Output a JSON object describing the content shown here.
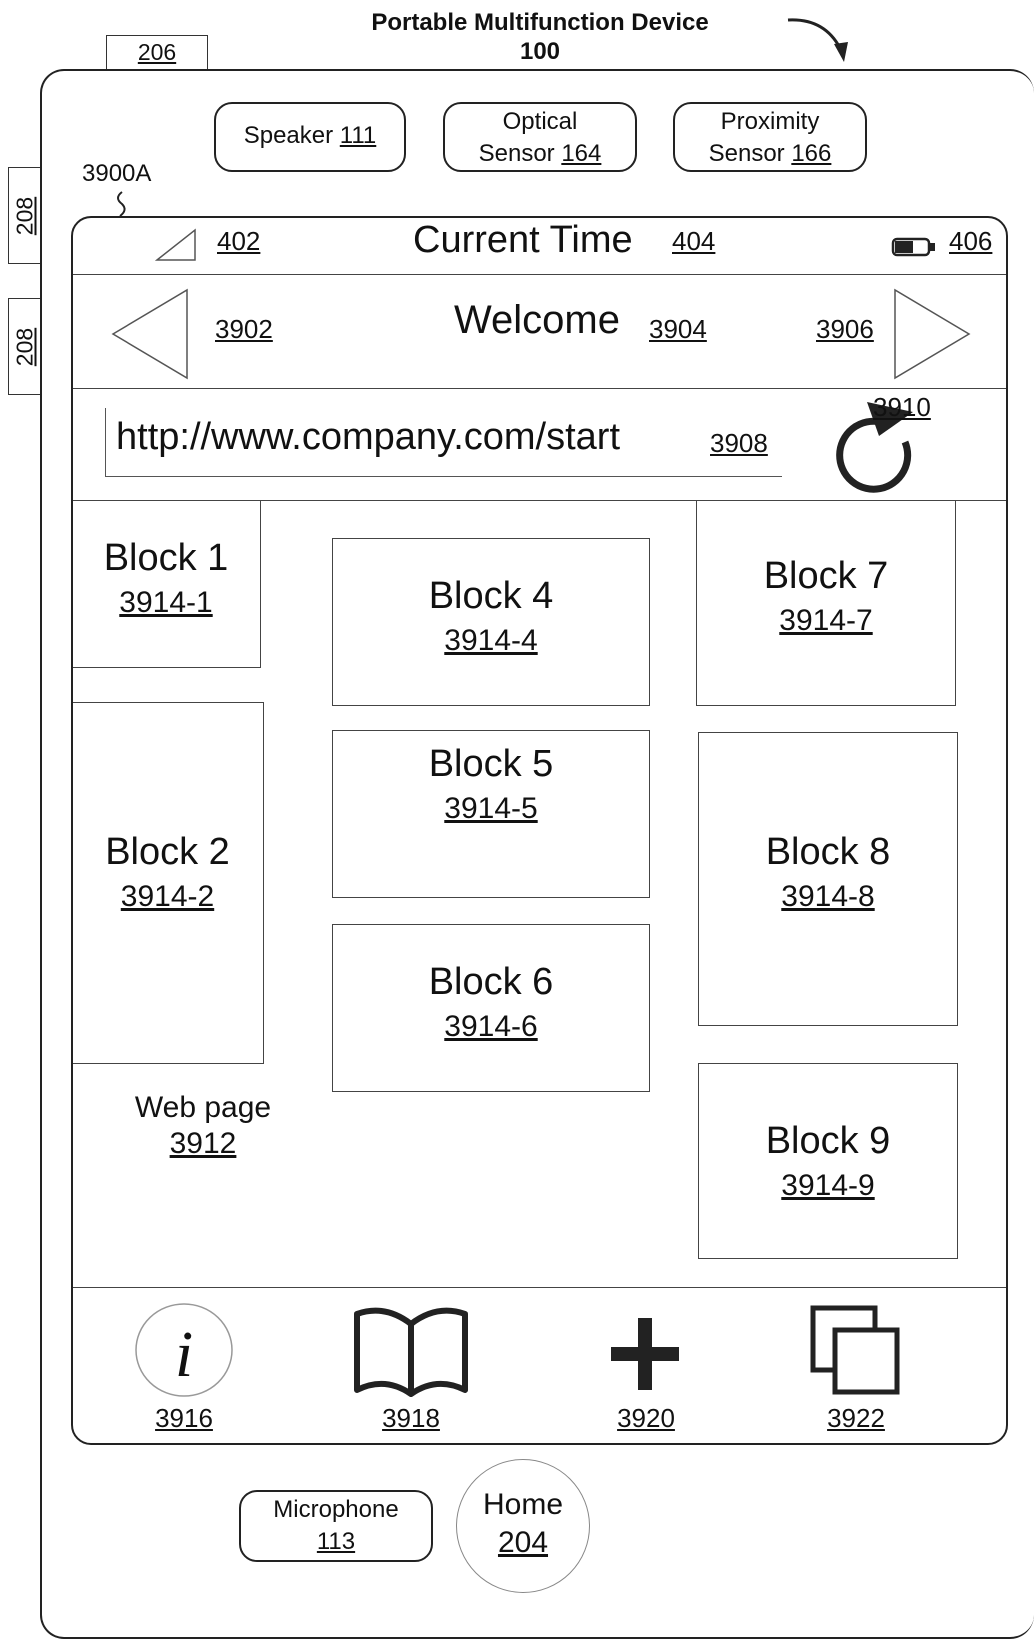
{
  "header": {
    "title": "Portable Multifunction Device",
    "number": "100",
    "tab_top": "206",
    "side_tabs": [
      "208",
      "208"
    ],
    "screen_label": "3900A"
  },
  "sensors": [
    {
      "name": "Speaker",
      "ref": "111"
    },
    {
      "name": "Optical",
      "name2": "Sensor",
      "ref": "164"
    },
    {
      "name": "Proximity",
      "name2": "Sensor",
      "ref": "166"
    }
  ],
  "status_bar": {
    "signal_ref": "402",
    "time_label": "Current Time",
    "time_ref": "404",
    "battery_ref": "406"
  },
  "nav_bar": {
    "back_ref": "3902",
    "title": "Welcome",
    "title_ref": "3904",
    "forward_ref": "3906"
  },
  "url_bar": {
    "url": "http://www.company.com/start",
    "url_ref": "3908",
    "refresh_ref": "3910"
  },
  "web_page": {
    "label": "Web page",
    "ref": "3912",
    "blocks": [
      {
        "title": "Block 1",
        "ref": "3914-1"
      },
      {
        "title": "Block 2",
        "ref": "3914-2"
      },
      {
        "title": "Block 4",
        "ref": "3914-4"
      },
      {
        "title": "Block 5",
        "ref": "3914-5"
      },
      {
        "title": "Block 6",
        "ref": "3914-6"
      },
      {
        "title": "Block 7",
        "ref": "3914-7"
      },
      {
        "title": "Block 8",
        "ref": "3914-8"
      },
      {
        "title": "Block 9",
        "ref": "3914-9"
      }
    ]
  },
  "toolbar": [
    {
      "icon": "info-icon",
      "ref": "3916"
    },
    {
      "icon": "book-icon",
      "ref": "3918"
    },
    {
      "icon": "plus-icon",
      "ref": "3920"
    },
    {
      "icon": "pages-icon",
      "ref": "3922"
    }
  ],
  "bottom": {
    "microphone": "Microphone",
    "microphone_ref": "113",
    "home": "Home",
    "home_ref": "204"
  }
}
